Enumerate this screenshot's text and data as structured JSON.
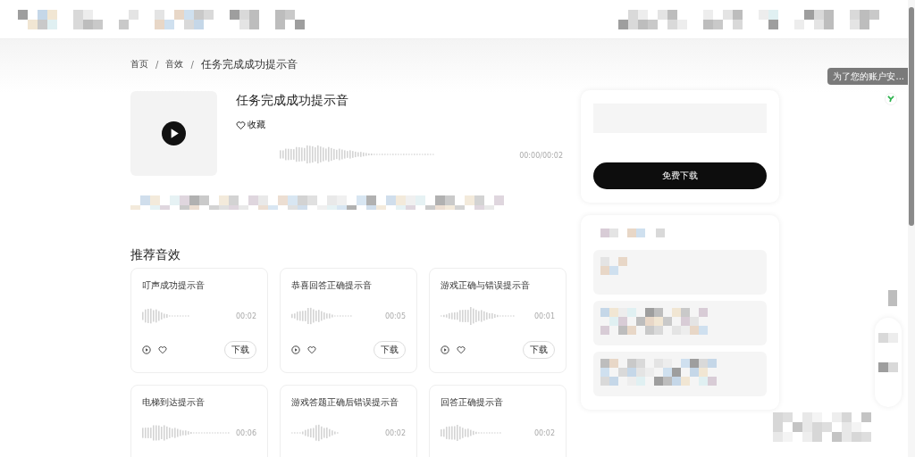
{
  "tooltip": "为了您的账户安...",
  "breadcrumb": {
    "items": [
      "首页",
      "音效",
      "任务完成成功提示音"
    ],
    "separators": [
      "/",
      "/"
    ]
  },
  "sound": {
    "title": "任务完成成功提示音",
    "favorite_label": "收藏",
    "time": "00:00/00:02"
  },
  "download_button": "免费下载",
  "recommended": {
    "heading": "推荐音效",
    "items": [
      {
        "title": "叮声成功提示音",
        "duration": "00:02",
        "download_label": "下载"
      },
      {
        "title": "恭喜回答正确提示音",
        "duration": "00:05",
        "download_label": "下载"
      },
      {
        "title": "游戏正确与错误提示音",
        "duration": "00:01",
        "download_label": "下载"
      },
      {
        "title": "电梯到达提示音",
        "duration": "00:06"
      },
      {
        "title": "游戏答题正确后错误提示音",
        "duration": "00:02"
      },
      {
        "title": "回答正确提示音",
        "duration": "00:02"
      }
    ]
  }
}
